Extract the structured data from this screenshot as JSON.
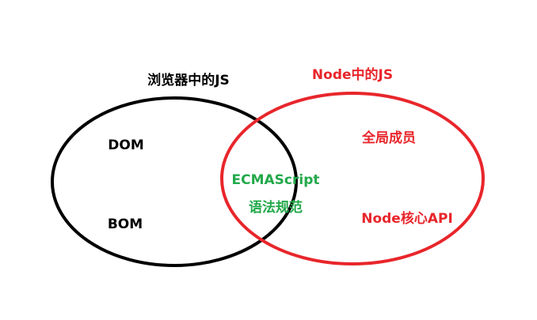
{
  "left_set": {
    "title": "浏览器中的JS",
    "items": [
      "DOM",
      "BOM"
    ],
    "color": "#000000"
  },
  "right_set": {
    "title": "Node中的JS",
    "items": [
      "全局成员",
      "Node核心API"
    ],
    "color": "#e8262b"
  },
  "intersection": {
    "items": [
      "ECMAScript",
      "语法规范"
    ],
    "color": "#22a94a"
  }
}
